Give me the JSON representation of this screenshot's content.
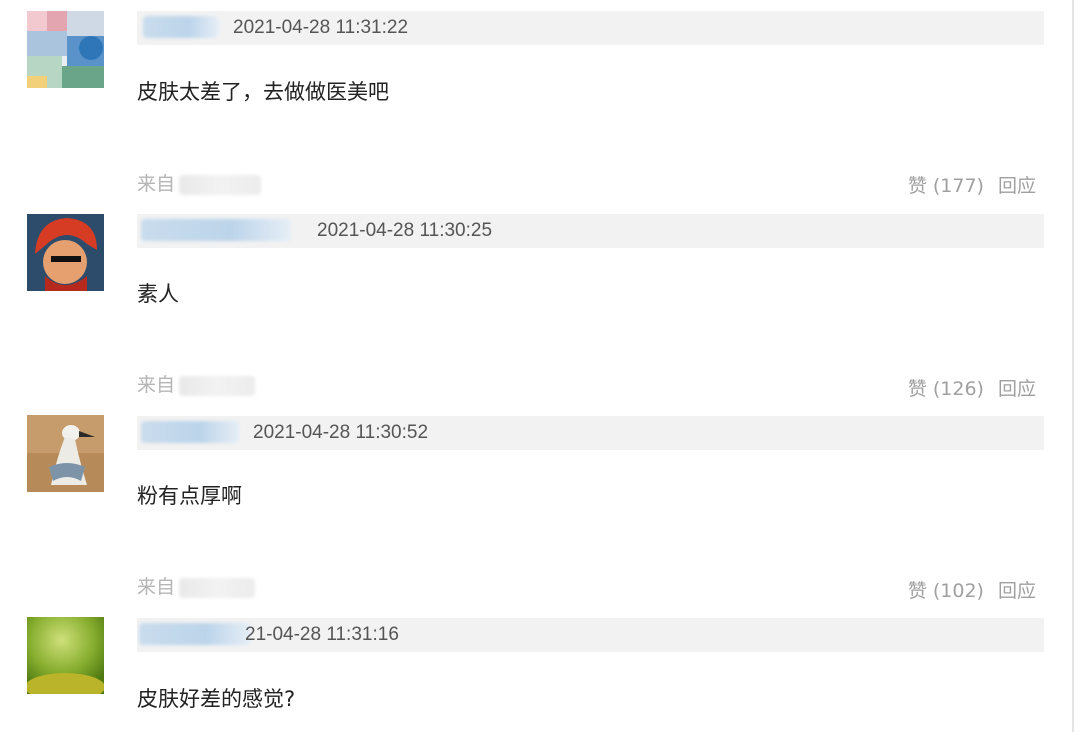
{
  "comments": [
    {
      "timestamp": "2021-04-28 11:31:22",
      "text": "皮肤太差了，去做做医美吧",
      "source_prefix": "来自",
      "like_label": "赞 (177)",
      "reply_label": "回应"
    },
    {
      "timestamp": "2021-04-28 11:30:25",
      "text": "素人",
      "source_prefix": "来自",
      "like_label": "赞 (126)",
      "reply_label": "回应"
    },
    {
      "timestamp": "2021-04-28 11:30:52",
      "text": "粉有点厚啊",
      "source_prefix": "来自",
      "like_label": "赞 (102)",
      "reply_label": "回应"
    },
    {
      "timestamp": "21-04-28 11:31:16",
      "text": "皮肤好差的感觉?"
    }
  ],
  "colors": {
    "header_bg": "#f2f2f2",
    "timestamp": "#555555",
    "text": "#222222",
    "muted": "#a0a0a0"
  }
}
